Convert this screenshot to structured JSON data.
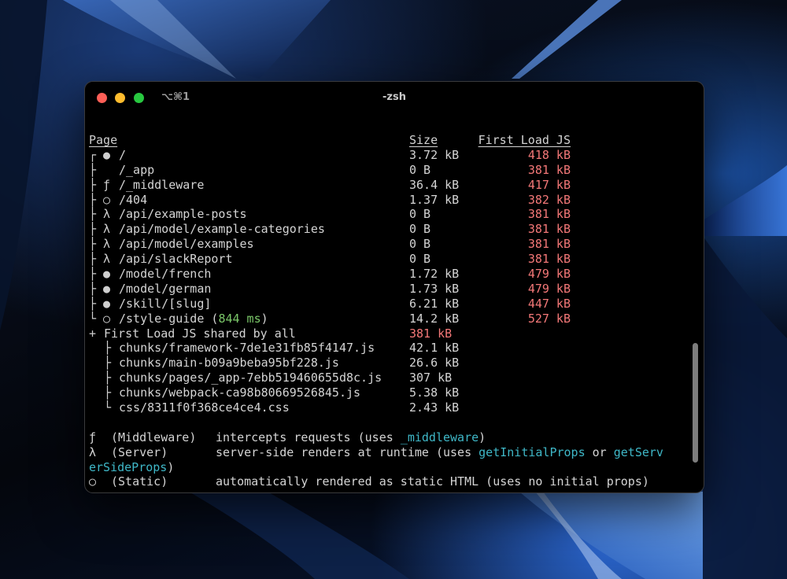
{
  "window": {
    "title": "-zsh",
    "shortcut": "⌥⌘1"
  },
  "header": {
    "page": "Page",
    "size": "Size",
    "first_load": "First Load JS"
  },
  "routes": [
    {
      "tree": "┌ ●",
      "route": "/",
      "size": "3.72 kB",
      "first": "418 kB"
    },
    {
      "tree": "├  ",
      "route": "/_app",
      "size": "0 B",
      "first": "381 kB"
    },
    {
      "tree": "├ ƒ",
      "route": "/_middleware",
      "size": "36.4 kB",
      "first": "417 kB"
    },
    {
      "tree": "├ ○",
      "route": "/404",
      "size": "1.37 kB",
      "first": "382 kB"
    },
    {
      "tree": "├ λ",
      "route": "/api/example-posts",
      "size": "0 B",
      "first": "381 kB"
    },
    {
      "tree": "├ λ",
      "route": "/api/model/example-categories",
      "size": "0 B",
      "first": "381 kB"
    },
    {
      "tree": "├ λ",
      "route": "/api/model/examples",
      "size": "0 B",
      "first": "381 kB"
    },
    {
      "tree": "├ λ",
      "route": "/api/slackReport",
      "size": "0 B",
      "first": "381 kB"
    },
    {
      "tree": "├ ●",
      "route": "/model/french",
      "size": "1.72 kB",
      "first": "479 kB"
    },
    {
      "tree": "├ ●",
      "route": "/model/german",
      "size": "1.73 kB",
      "first": "479 kB"
    },
    {
      "tree": "├ ●",
      "route": "/skill/[slug]",
      "size": "6.21 kB",
      "first": "447 kB"
    },
    {
      "tree": "└ ○",
      "route": "/style-guide",
      "route_extra_open": " (",
      "route_ms": "844 ms",
      "route_extra_close": ")",
      "size": "14.2 kB",
      "first": "527 kB"
    }
  ],
  "shared": {
    "prefix": "+",
    "label": "First Load JS shared by all",
    "size": "381 kB",
    "chunks": [
      {
        "tree": "├",
        "name": "chunks/framework-7de1e31fb85f4147.js",
        "size": "42.1 kB"
      },
      {
        "tree": "├",
        "name": "chunks/main-b09a9beba95bf228.js",
        "size": "26.6 kB"
      },
      {
        "tree": "├",
        "name": "chunks/pages/_app-7ebb519460655d8c.js",
        "size": "307 kB"
      },
      {
        "tree": "├",
        "name": "chunks/webpack-ca98b80669526845.js",
        "size": "5.38 kB"
      },
      {
        "tree": "└",
        "name": "css/8311f0f368ce4ce4.css",
        "size": "2.43 kB"
      }
    ]
  },
  "legend": [
    {
      "key": "ƒ",
      "label": "(Middleware)",
      "pre": "intercepts requests (uses ",
      "code": "_middleware",
      "post": ")"
    },
    {
      "key": "λ",
      "label": "(Server)",
      "pre": "server-side renders at runtime (uses ",
      "code": "getInitialProps",
      "mid": " or ",
      "code2": "getServ"
    },
    {
      "key": "",
      "label": "",
      "cont": "erSideProps",
      "post": ")"
    },
    {
      "key": "○",
      "label": "(Static)",
      "pre": "automatically rendered as static HTML (uses no initial props)"
    }
  ],
  "colors": {
    "first_load": "#f47878",
    "timing": "#7cc96a",
    "code": "#3fb8c8"
  }
}
